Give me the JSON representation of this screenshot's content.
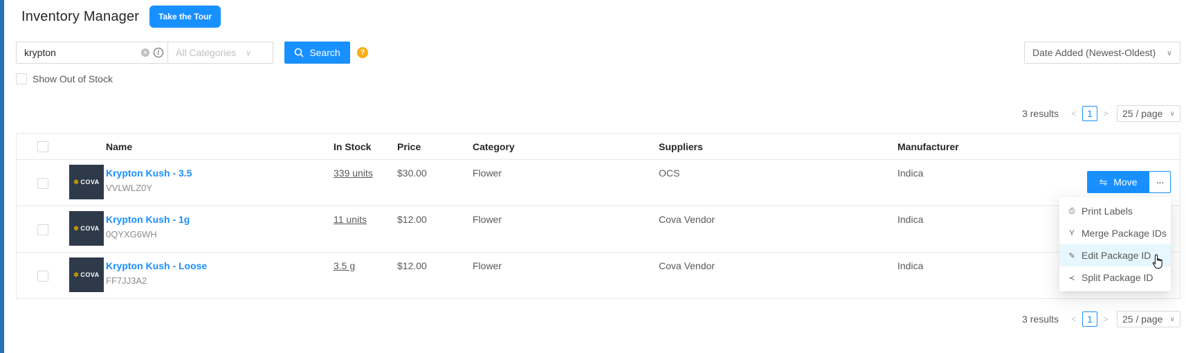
{
  "app": {
    "title": "Inventory Manager",
    "tour_button": "Take the Tour"
  },
  "search": {
    "value": "krypton",
    "category_placeholder": "All Categories",
    "search_button": "Search",
    "sort_value": "Date Added (Newest-Oldest)"
  },
  "filters": {
    "show_out_of_stock": "Show Out of Stock"
  },
  "pagination": {
    "total": "3 results",
    "current_page": "1",
    "page_size": "25 / page"
  },
  "table": {
    "headers": {
      "name": "Name",
      "in_stock": "In Stock",
      "price": "Price",
      "category": "Category",
      "suppliers": "Suppliers",
      "manufacturer": "Manufacturer"
    },
    "thumb_text": "COVA",
    "rows": [
      {
        "name": "Krypton Kush - 3.5",
        "sku": "VVLWLZ0Y",
        "in_stock": "339 units",
        "price": "$30.00",
        "category": "Flower",
        "supplier": "OCS",
        "manufacturer": "Indica"
      },
      {
        "name": "Krypton Kush - 1g",
        "sku": "0QYXG6WH",
        "in_stock": "11 units",
        "price": "$12.00",
        "category": "Flower",
        "supplier": "Cova Vendor",
        "manufacturer": "Indica"
      },
      {
        "name": "Krypton Kush - Loose",
        "sku": "FF7JJ3A2",
        "in_stock": "3.5 g",
        "price": "$12.00",
        "category": "Flower",
        "supplier": "Cova Vendor",
        "manufacturer": "Indica"
      }
    ]
  },
  "row_actions": {
    "move_button": "Move",
    "more_button": "···",
    "menu": [
      {
        "label": "Print Labels",
        "icon": "printer-icon"
      },
      {
        "label": "Merge Package IDs",
        "icon": "merge-icon"
      },
      {
        "label": "Edit Package ID",
        "icon": "pencil-icon"
      },
      {
        "label": "Split Package ID",
        "icon": "share-icon"
      }
    ],
    "hovered_item": "Edit Package ID"
  },
  "colors": {
    "primary": "#1890ff",
    "help": "#faad14",
    "stripe": "#2a6fb8",
    "thumb_bg": "#2e3a4a"
  }
}
